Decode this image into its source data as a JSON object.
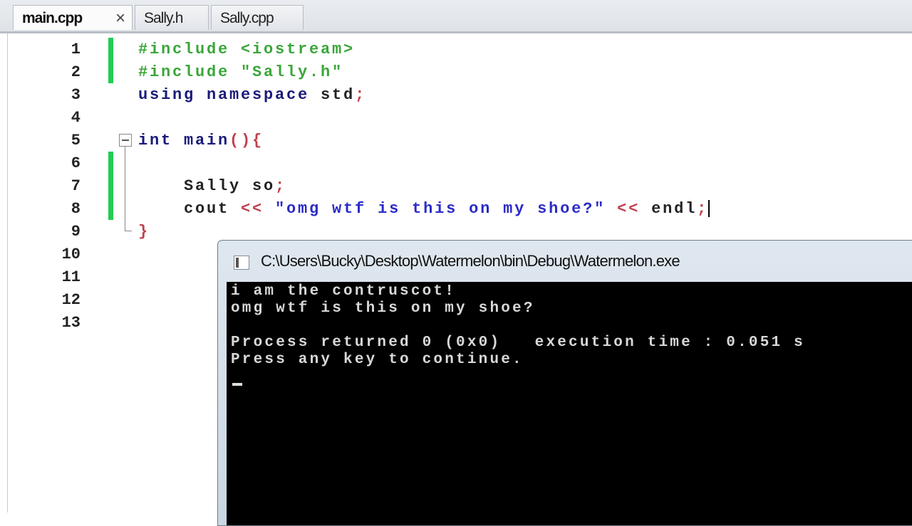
{
  "tabs": [
    {
      "label": "main.cpp",
      "active": true,
      "close": "×"
    },
    {
      "label": "Sally.h"
    },
    {
      "label": "Sally.cpp"
    }
  ],
  "editor": {
    "line_numbers": [
      "1",
      "2",
      "3",
      "4",
      "5",
      "6",
      "7",
      "8",
      "9",
      "10",
      "11",
      "12",
      "13"
    ],
    "lines": {
      "l1": "#include <iostream>",
      "l2": "#include \"Sally.h\"",
      "l3a": "using namespace ",
      "l3b": "std",
      "l3c": ";",
      "l5a": "int main",
      "l5b": "(){",
      "l7a": "    Sally so",
      "l7b": ";",
      "l8a": "    cout ",
      "l8b": "<< ",
      "l8c": "\"omg wtf is this on my shoe?\"",
      "l8d": " << ",
      "l8e": "endl",
      "l8f": ";",
      "l9": "}"
    }
  },
  "console": {
    "title": "C:\\Users\\Bucky\\Desktop\\Watermelon\\bin\\Debug\\Watermelon.exe",
    "output": [
      "i am the contruscot!",
      "omg wtf is this on my shoe?",
      "",
      "Process returned 0 (0x0)   execution time : 0.051 s",
      "Press any key to continue."
    ]
  }
}
